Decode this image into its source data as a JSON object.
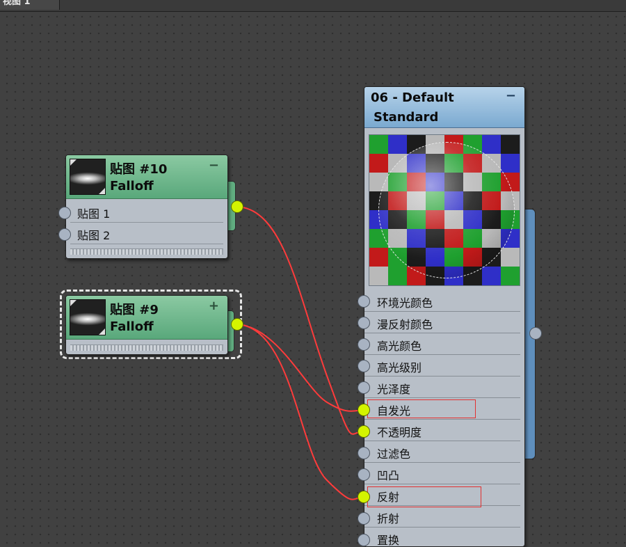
{
  "viewport": {
    "tab_label": "视图 1"
  },
  "node_map10": {
    "title": "贴图 #10",
    "type": "Falloff",
    "collapse_symbol": "−",
    "slots": [
      {
        "label": "贴图 1"
      },
      {
        "label": "贴图 2"
      }
    ]
  },
  "node_map9": {
    "title": "贴图 #9",
    "type": "Falloff",
    "expand_symbol": "+"
  },
  "material": {
    "title": "06 - Default",
    "type": "Standard",
    "collapse_symbol": "−",
    "slots": [
      {
        "label": "环境光颜色",
        "connected": false
      },
      {
        "label": "漫反射颜色",
        "connected": false
      },
      {
        "label": "高光颜色",
        "connected": false
      },
      {
        "label": "高光级别",
        "connected": false
      },
      {
        "label": "光泽度",
        "connected": false
      },
      {
        "label": "自发光",
        "connected": true,
        "highlighted": true
      },
      {
        "label": "不透明度",
        "connected": true,
        "highlighted": false
      },
      {
        "label": "过滤色",
        "connected": false
      },
      {
        "label": "凹凸",
        "connected": false
      },
      {
        "label": "反射",
        "connected": true,
        "highlighted": true
      },
      {
        "label": "折射",
        "connected": false
      },
      {
        "label": "置换",
        "connected": false
      }
    ]
  },
  "colors": {
    "wire": "#ff3b3b",
    "active_port": "#d4f400",
    "map_node_header": "#6fb88c",
    "material_header": "#8fb7db",
    "highlight_box": "#e23030"
  }
}
